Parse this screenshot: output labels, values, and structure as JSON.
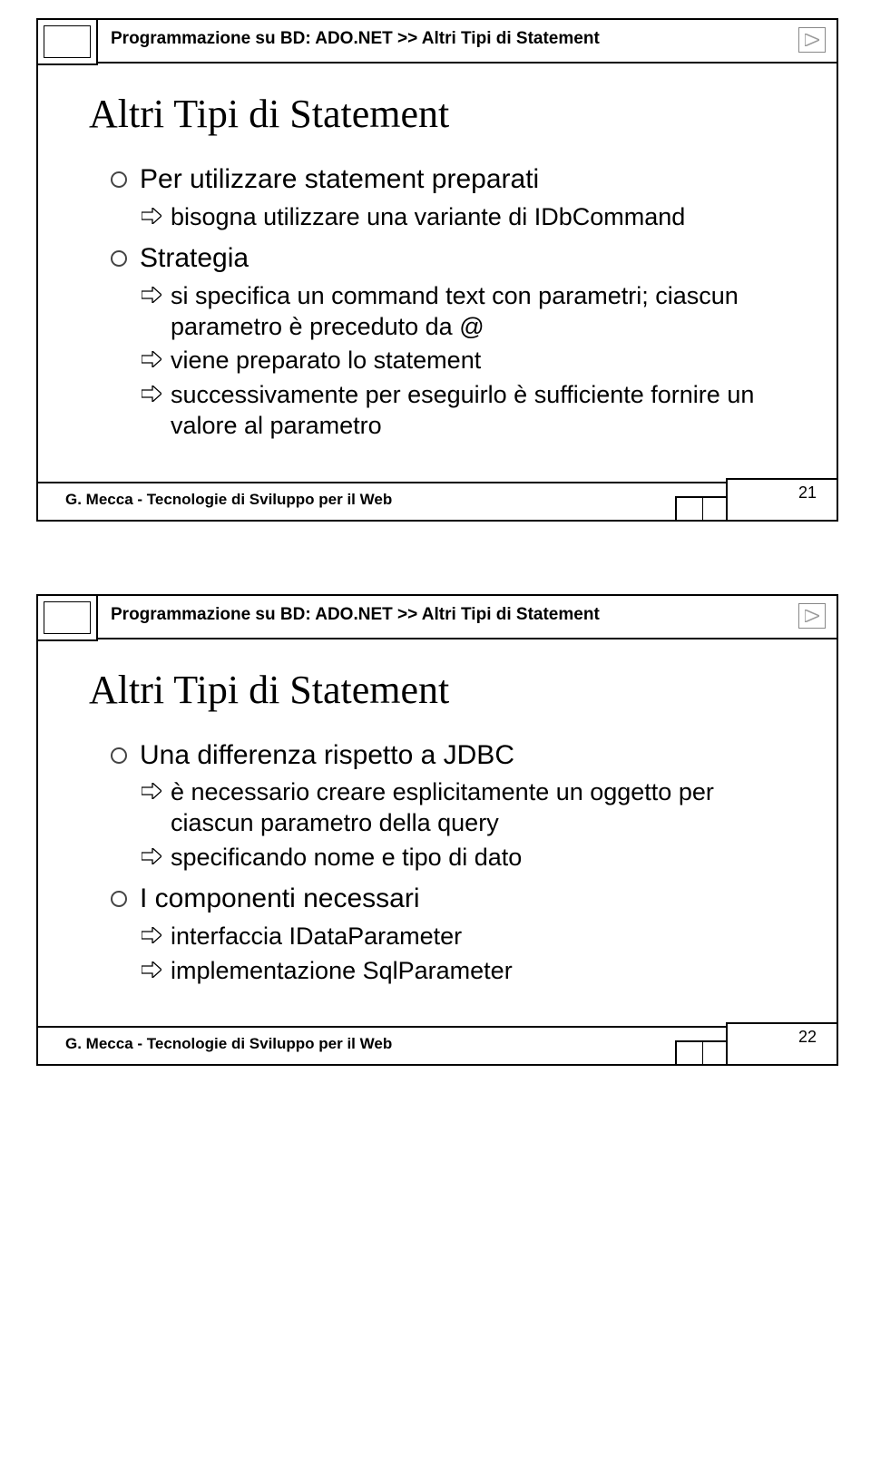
{
  "slides": [
    {
      "breadcrumb": "Programmazione su BD: ADO.NET >> Altri Tipi di Statement",
      "title": "Altri Tipi di Statement",
      "footer_author": "G. Mecca - Tecnologie di Sviluppo per il Web",
      "page_num": "21",
      "bullets": [
        {
          "text": "Per utilizzare statement preparati",
          "children": [
            {
              "text": "bisogna utilizzare una variante di IDbCommand"
            }
          ]
        },
        {
          "text": "Strategia",
          "children": [
            {
              "text": "si specifica un command text con parametri; ciascun parametro è preceduto da @"
            },
            {
              "text": "viene preparato lo statement"
            },
            {
              "text": "successivamente per eseguirlo è sufficiente fornire un valore al parametro"
            }
          ]
        }
      ]
    },
    {
      "breadcrumb": "Programmazione su BD: ADO.NET >> Altri Tipi di Statement",
      "title": "Altri Tipi di Statement",
      "footer_author": "G. Mecca - Tecnologie di Sviluppo per il Web",
      "page_num": "22",
      "bullets": [
        {
          "text": "Una differenza rispetto a JDBC",
          "children": [
            {
              "text": "è necessario creare esplicitamente un oggetto per ciascun parametro della query"
            },
            {
              "text": "specificando nome e tipo di dato"
            }
          ]
        },
        {
          "text": "I componenti necessari",
          "children": [
            {
              "text": "interfaccia IDataParameter"
            },
            {
              "text": "implementazione SqlParameter"
            }
          ]
        }
      ]
    }
  ]
}
